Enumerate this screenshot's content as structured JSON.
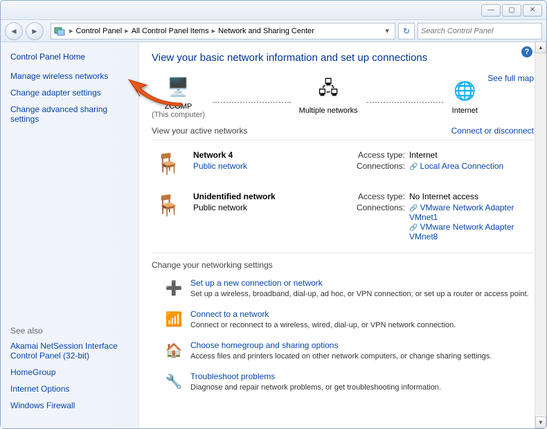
{
  "titlebar": {
    "min": "—",
    "max": "▢",
    "close": "✕"
  },
  "breadcrumb": {
    "items": [
      "Control Panel",
      "All Control Panel Items",
      "Network and Sharing Center"
    ]
  },
  "search": {
    "placeholder": "Search Control Panel"
  },
  "sidebar": {
    "home": "Control Panel Home",
    "links": {
      "manage_wireless": "Manage wireless networks",
      "adapter": "Change adapter settings",
      "advanced": "Change advanced sharing settings"
    },
    "seealso_title": "See also",
    "seealso": {
      "akamai": "Akamai NetSession Interface Control Panel (32-bit)",
      "homegroup": "HomeGroup",
      "inet": "Internet Options",
      "firewall": "Windows Firewall"
    }
  },
  "heading": "View your basic network information and set up connections",
  "fullmap": "See full map",
  "map": {
    "node1": "ZCOMP",
    "node1_sub": "(This computer)",
    "node2": "Multiple networks",
    "node3": "Internet"
  },
  "active_label": "View your active networks",
  "connect_link": "Connect or disconnect",
  "net1": {
    "name": "Network  4",
    "type": "Public network",
    "access_lbl": "Access type:",
    "access_val": "Internet",
    "conn_lbl": "Connections:",
    "conn_val": "Local Area Connection"
  },
  "net2": {
    "name": "Unidentified network",
    "type": "Public network",
    "access_lbl": "Access type:",
    "access_val": "No Internet access",
    "conn_lbl": "Connections:",
    "conn_val1": "VMware Network Adapter VMnet1",
    "conn_val2": "VMware Network Adapter VMnet8"
  },
  "chg_heading": "Change your networking settings",
  "tasks": {
    "t1": {
      "link": "Set up a new connection or network",
      "desc": "Set up a wireless, broadband, dial-up, ad hoc, or VPN connection; or set up a router or access point."
    },
    "t2": {
      "link": "Connect to a network",
      "desc": "Connect or reconnect to a wireless, wired, dial-up, or VPN network connection."
    },
    "t3": {
      "link": "Choose homegroup and sharing options",
      "desc": "Access files and printers located on other network computers, or change sharing settings."
    },
    "t4": {
      "link": "Troubleshoot problems",
      "desc": "Diagnose and repair network problems, or get troubleshooting information."
    }
  }
}
